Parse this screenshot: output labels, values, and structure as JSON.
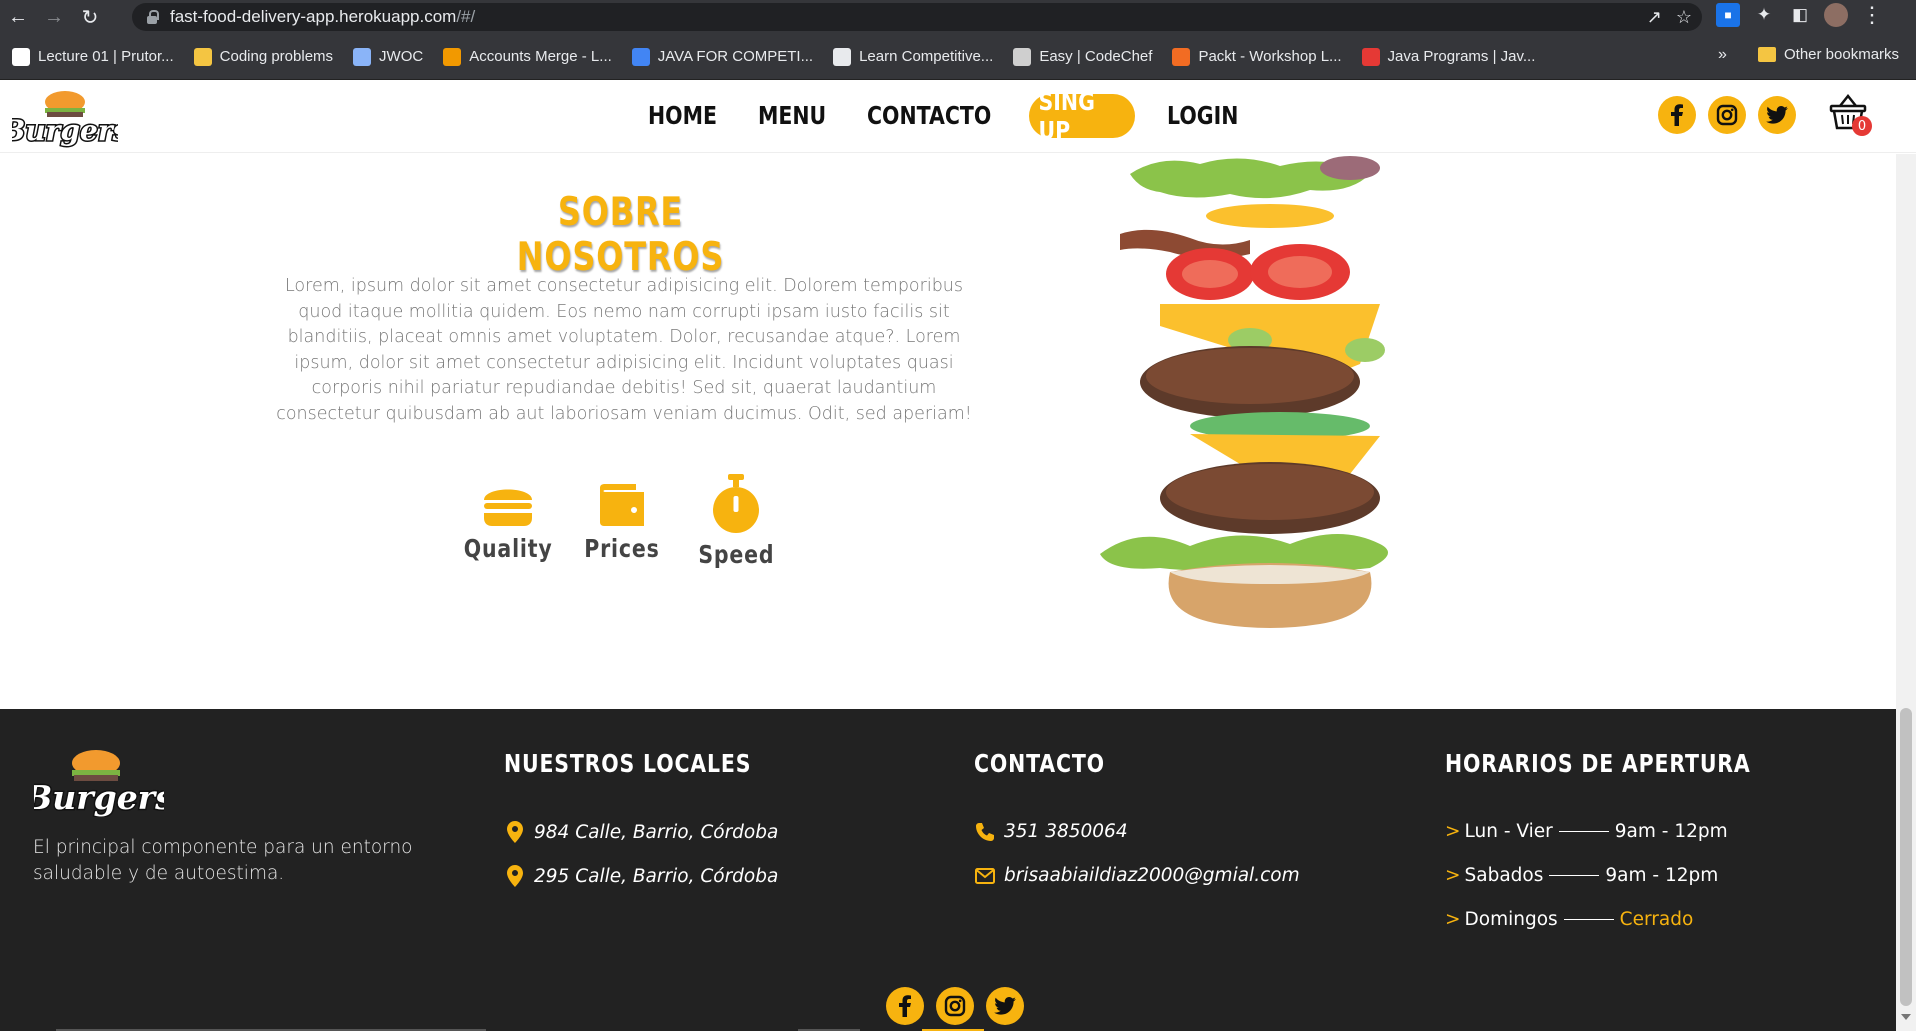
{
  "browser": {
    "url_host": "fast-food-delivery-app.herokuapp.com",
    "url_path": "/#/",
    "bookmarks": [
      {
        "label": "Lecture 01 | Prutor...",
        "color": "#ffffff"
      },
      {
        "label": "Coding problems",
        "color": "#f4c542"
      },
      {
        "label": "JWOC",
        "color": "#8ab4f8"
      },
      {
        "label": "Accounts Merge - L...",
        "color": "#f29900"
      },
      {
        "label": "JAVA FOR COMPETI...",
        "color": "#4285f4"
      },
      {
        "label": "Learn Competitive...",
        "color": "#e8eaed"
      },
      {
        "label": "Easy | CodeChef",
        "color": "#cfcfcf"
      },
      {
        "label": "Packt - Workshop L...",
        "color": "#f26c23"
      },
      {
        "label": "Java Programs | Jav...",
        "color": "#e53935"
      }
    ],
    "more_label": "»",
    "other_bookmarks": "Other bookmarks"
  },
  "header": {
    "logo_text": "Burgers",
    "nav": {
      "home": "HOME",
      "menu": "MENU",
      "contacto": "CONTACTO",
      "signup": "SING UP",
      "login": "LOGIN"
    },
    "cart_count": "0"
  },
  "about": {
    "title": "SOBRE NOSOTROS",
    "text": "Lorem, ipsum dolor sit amet consectetur adipisicing elit. Dolorem temporibus quod itaque mollitia quidem. Eos nemo nam corrupti ipsam iusto facilis sit blanditiis, placeat omnis amet voluptatem. Dolor, recusandae atque?. Lorem ipsum, dolor sit amet consectetur adipisicing elit. Incidunt voluptates quasi corporis nihil pariatur repudiandae debitis! Sed sit, quaerat laudantium consectetur quibusdam ab aut laboriosam veniam ducimus. Odit, sed aperiam!",
    "features": {
      "quality": "Quality",
      "prices": "Prices",
      "speed": "Speed"
    }
  },
  "footer": {
    "logo_text": "Burgers",
    "tagline": "El principal componente para un entorno saludable y de autoestima.",
    "locales_title": "NUESTROS LOCALES",
    "locales": [
      "984 Calle, Barrio, Córdoba",
      "295 Calle, Barrio, Córdoba"
    ],
    "contacto_title": "CONTACTO",
    "phone": "351 3850064",
    "email": "brisaabiaildiaz2000@gmial.com",
    "horarios_title": "HORARIOS DE APERTURA",
    "horarios": [
      {
        "day": "Lun - Vier",
        "time": "9am - 12pm"
      },
      {
        "day": "Sabados",
        "time": "9am - 12pm"
      },
      {
        "day": "Domingos",
        "time": "Cerrado"
      }
    ]
  },
  "colors": {
    "accent": "#f7b30f",
    "footer_bg": "#222222",
    "chrome_bg": "#35363a"
  }
}
